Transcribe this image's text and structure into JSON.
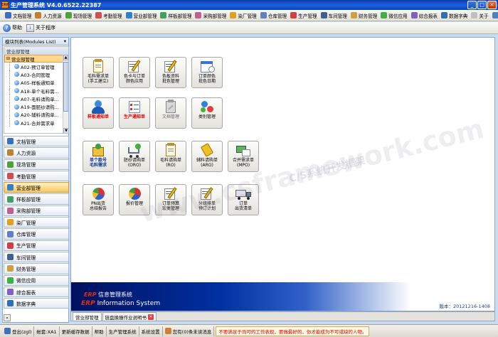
{
  "window": {
    "title": "生产管理系统 V4.0.6522.22387"
  },
  "menu": [
    {
      "label": "文档管理",
      "color": "#3a70c0"
    },
    {
      "label": "人力资源",
      "color": "#c08030"
    },
    {
      "label": "现场管理",
      "color": "#50a040"
    },
    {
      "label": "考勤管理",
      "color": "#d05050"
    },
    {
      "label": "营业部管理",
      "color": "#3080d0"
    },
    {
      "label": "样板部管理",
      "color": "#40a060"
    },
    {
      "label": "采购部管理",
      "color": "#c06090"
    },
    {
      "label": "染厂管理",
      "color": "#e0a020"
    },
    {
      "label": "仓库管理",
      "color": "#6080c0"
    },
    {
      "label": "生产管理",
      "color": "#d04040"
    },
    {
      "label": "车间管理",
      "color": "#406090"
    },
    {
      "label": "财务管理",
      "color": "#d0a040"
    },
    {
      "label": "微信应用",
      "color": "#40b040"
    },
    {
      "label": "综合报表",
      "color": "#8060c0"
    },
    {
      "label": "数据字典",
      "color": "#3070b0"
    },
    {
      "label": "关于",
      "color": "#c0c0c0"
    },
    {
      "label": "窗口",
      "color": "#5080c0"
    }
  ],
  "toolbar": {
    "help_label": "帮助",
    "about_label": "关于程序"
  },
  "modules_panel": {
    "title": "模块列表(Modules List)",
    "tree_header": "营业部管理",
    "tree_root": "营业部管理",
    "tree_items": [
      "A02-预订单管理",
      "A03-合同管理",
      "A05-样板通知单",
      "A18-单个毛料需...",
      "A07-毛料请购单...",
      "A19-面胚纱请购...",
      "A20-辅料请购单...",
      "A21-合并需求单"
    ],
    "module_buttons": [
      {
        "label": "文档管理",
        "color": "#3a70c0",
        "active": false
      },
      {
        "label": "人力资源",
        "color": "#c08030",
        "active": false
      },
      {
        "label": "现场管理",
        "color": "#50a040",
        "active": false
      },
      {
        "label": "考勤管理",
        "color": "#d05050",
        "active": false
      },
      {
        "label": "营业部管理",
        "color": "#3080d0",
        "active": true
      },
      {
        "label": "样板部管理",
        "color": "#40a060",
        "active": false
      },
      {
        "label": "采购部管理",
        "color": "#c06090",
        "active": false
      },
      {
        "label": "染厂管理",
        "color": "#e0a020",
        "active": false
      },
      {
        "label": "仓库管理",
        "color": "#6080c0",
        "active": false
      },
      {
        "label": "生产管理",
        "color": "#d04040",
        "active": false
      },
      {
        "label": "车间管理",
        "color": "#406090",
        "active": false
      },
      {
        "label": "财务管理",
        "color": "#d0a040",
        "active": false
      },
      {
        "label": "微信应用",
        "color": "#40b040",
        "active": false
      },
      {
        "label": "综合报表",
        "color": "#8060c0",
        "active": false
      },
      {
        "label": "数据字典",
        "color": "#3070b0",
        "active": false
      }
    ]
  },
  "grid": [
    {
      "label": "毛料需求单\n(手工建立)",
      "style": "normal",
      "icon": "notepad-icon"
    },
    {
      "label": "色卡与订单\n颜色应用",
      "style": "normal",
      "icon": "pencil-paper-icon"
    },
    {
      "label": "色板资料\n批色管理",
      "style": "normal",
      "icon": "pencil-paper-icon"
    },
    {
      "label": "订单颜色\n批色日期",
      "style": "normal",
      "icon": "calendar-icon"
    },
    {
      "label": "样板通知单",
      "style": "red",
      "icon": "user-icon"
    },
    {
      "label": "生产通知单",
      "style": "red",
      "icon": "checklist-icon"
    },
    {
      "label": "文档管理",
      "style": "gray",
      "icon": "clipboard-icon"
    },
    {
      "label": "类别管理",
      "style": "normal",
      "icon": "molecule-icon"
    },
    {
      "label": "单个款号\n毛料需求",
      "style": "blue",
      "icon": "dollar-box-icon"
    },
    {
      "label": "胚纱请购单\n(ORO)",
      "style": "normal",
      "icon": "cart-icon"
    },
    {
      "label": "毛料请购单\n(RO)",
      "style": "normal",
      "icon": "notepad-icon"
    },
    {
      "label": "辅料请购单\n(ARO)",
      "style": "normal",
      "icon": "tag-icon"
    },
    {
      "label": "合并需求单\n(MPO)",
      "style": "normal",
      "icon": "abc-money-icon"
    },
    {
      "label": "PN出货\n总结报告",
      "style": "normal",
      "icon": "pie-chart-icon"
    },
    {
      "label": "报价管理",
      "style": "normal",
      "icon": "pie-chart-icon"
    },
    {
      "label": "订单预算\n宏类管理",
      "style": "normal",
      "icon": "pencil-paper-icon"
    },
    {
      "label": "分组排单\n预订计划",
      "style": "normal",
      "icon": "pencil-paper-icon"
    },
    {
      "label": "订单\n出货清单",
      "style": "normal",
      "icon": "truck-icon"
    }
  ],
  "watermark": {
    "main": "www.csframework.com",
    "sub": "C/S系统开发框架"
  },
  "banner": {
    "line1_erp": "ERP",
    "line1": "信息管理系统",
    "line2_erp": "ERP",
    "line2": "Information System",
    "version": "版本：20121216-1408"
  },
  "tabs": [
    {
      "label": "营业部管理",
      "active": true,
      "closable": false
    },
    {
      "label": "链盘换撞作业说明书",
      "active": false,
      "closable": true
    }
  ],
  "statusbar": {
    "login": "登出(zgl)",
    "account": "帐套:XA1",
    "update": "更新缓存数据",
    "help": "帮助",
    "system": "生产管理系统",
    "settings": "系统设置",
    "messages": "您有(0)条未读消息",
    "alert": "不要满足于尚可的工作表现，要做最好的，你才能成为不可或缺的人物。"
  },
  "colors": {
    "accent": "#1c62e0",
    "active_module": "#f8c860",
    "alert_text": "#e00000"
  }
}
